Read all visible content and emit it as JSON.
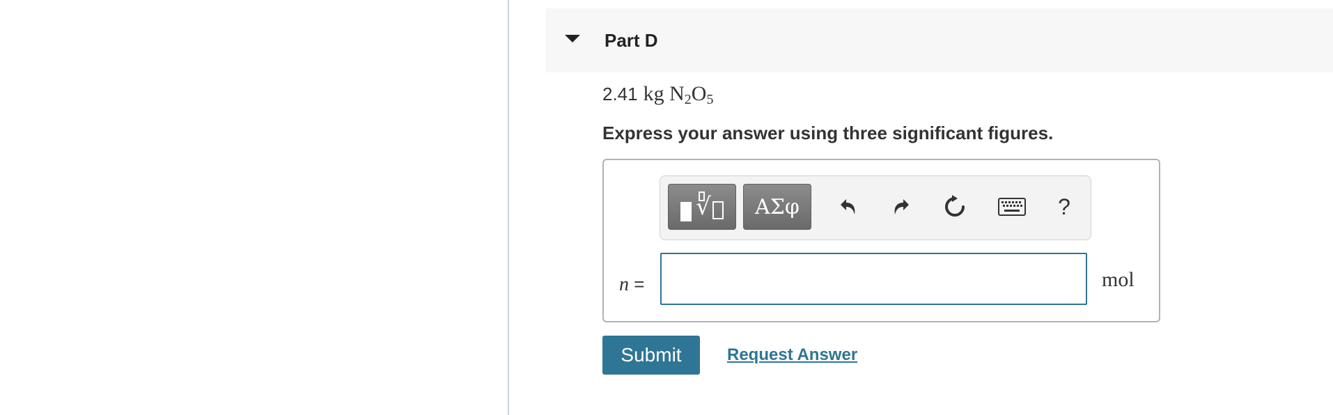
{
  "part": {
    "title": "Part D"
  },
  "question": {
    "amount": "2.41",
    "unit": "kg",
    "formula_parts": [
      "N",
      "2",
      "O",
      "5"
    ]
  },
  "instruction": "Express your answer using three significant figures.",
  "toolbar": {
    "symbols_label": "ΑΣφ",
    "help_label": "?",
    "icons": [
      "templates-icon",
      "symbols-icon",
      "undo-icon",
      "redo-icon",
      "reset-icon",
      "keyboard-icon",
      "help-icon"
    ]
  },
  "answer": {
    "variable": "n",
    "equals": "=",
    "value": "",
    "unit": "mol"
  },
  "actions": {
    "submit_label": "Submit",
    "request_answer_label": "Request Answer"
  },
  "colors": {
    "accent": "#2f7595",
    "header_bg": "#f7f7f7",
    "toolbar_button": "#7a7a7a"
  }
}
